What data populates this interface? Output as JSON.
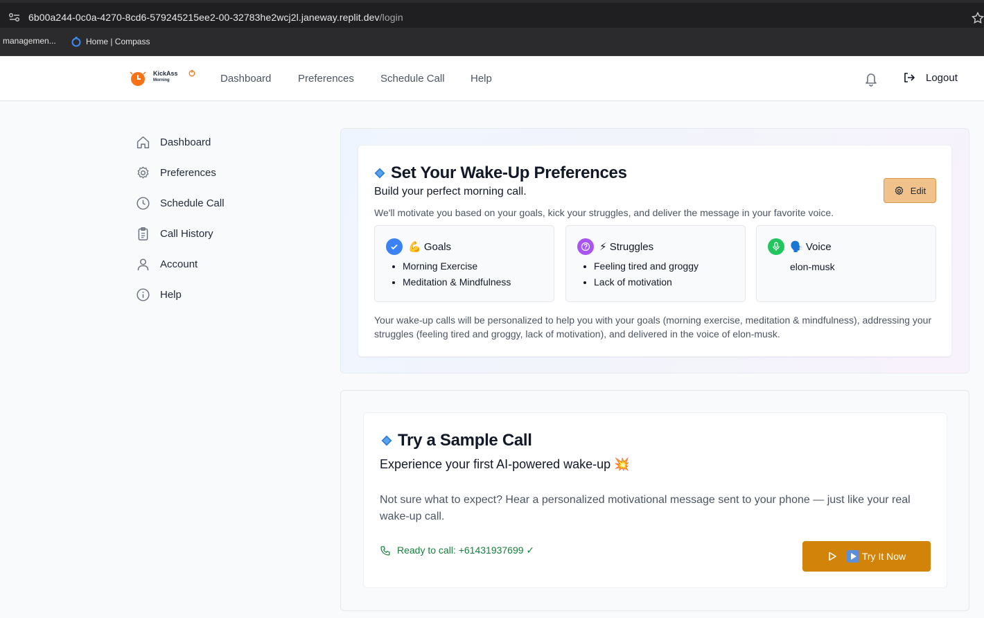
{
  "browser": {
    "url_host": "6b00a244-0c0a-4270-8cd6-579245215ee2-00-32783he2wcj2l.janeway.replit.dev",
    "url_path": "/login",
    "bookmarks": [
      "managemen...",
      "Home | Compass"
    ]
  },
  "header": {
    "logo_line1": "KickAss",
    "logo_line2": "Morning",
    "nav": [
      "Dashboard",
      "Preferences",
      "Schedule Call",
      "Help"
    ],
    "logout_label": "Logout"
  },
  "sidebar": {
    "items": [
      {
        "label": "Dashboard",
        "icon": "home-icon"
      },
      {
        "label": "Preferences",
        "icon": "gear-icon"
      },
      {
        "label": "Schedule Call",
        "icon": "clock-icon"
      },
      {
        "label": "Call History",
        "icon": "clipboard-icon"
      },
      {
        "label": "Account",
        "icon": "user-icon"
      },
      {
        "label": "Help",
        "icon": "info-icon"
      }
    ]
  },
  "preferences": {
    "title": "Set Your Wake-Up Preferences",
    "subtitle": "Build your perfect morning call.",
    "description": "We'll motivate you based on your goals, kick your struggles, and deliver the message in your favorite voice.",
    "edit_label": "Edit",
    "goals": {
      "heading": "💪 Goals",
      "items": [
        "Morning Exercise",
        "Meditation & Mindfulness"
      ]
    },
    "struggles": {
      "heading": "⚡ Struggles",
      "items": [
        "Feeling tired and groggy",
        "Lack of motivation"
      ]
    },
    "voice": {
      "heading": "🗣️ Voice",
      "value": "elon-musk"
    },
    "summary": "Your wake-up calls will be personalized to help you with your goals (morning exercise, meditation & mindfulness), addressing your struggles (feeling tired and groggy, lack of motivation), and delivered in the voice of elon-musk."
  },
  "sample_call": {
    "title": "Try a Sample Call",
    "subtitle": "Experience your first AI-powered wake-up 💥",
    "description": "Not sure what to expect? Hear a personalized motivational message sent to your phone — just like your real wake-up call.",
    "ready_text": "Ready to call: +61431937699 ✓",
    "try_label": "Try It Now"
  },
  "colors": {
    "accent_orange": "#d18409",
    "edit_bg": "#f0c18a",
    "goal_circle": "#3b82f6",
    "struggle_circle": "#a855f7",
    "voice_circle": "#22c55e",
    "ready_green": "#15803d"
  }
}
